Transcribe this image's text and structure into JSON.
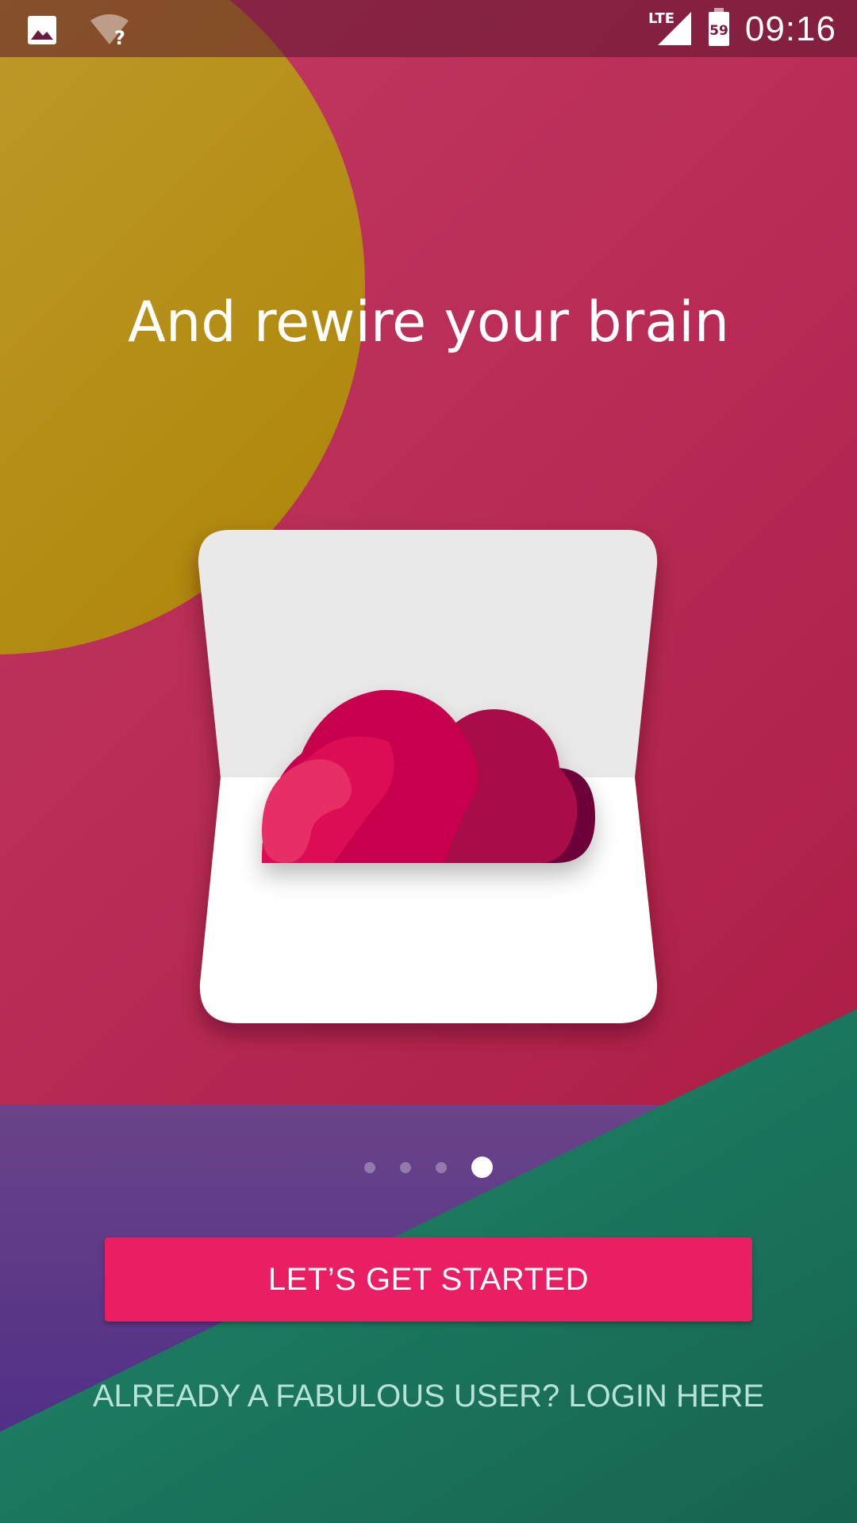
{
  "status_bar": {
    "time": "09:16",
    "network": "LTE",
    "battery_level": "59",
    "icons": [
      "image-icon",
      "wifi-unknown-icon",
      "signal-icon",
      "battery-icon"
    ]
  },
  "onboarding": {
    "headline": "And rewire your brain",
    "page_indicator": {
      "total": 4,
      "current": 4
    },
    "primary_button": "LET’S GET STARTED",
    "login_link": "ALREADY A FABULOUS USER? LOGIN HERE"
  },
  "colors": {
    "background": "#b52752",
    "yellow_circle": "#b8931e",
    "purple_band": "#5e3a8a",
    "green_band": "#1f7a63",
    "button": "#e91e63",
    "link_text": "#b7e3d6"
  }
}
